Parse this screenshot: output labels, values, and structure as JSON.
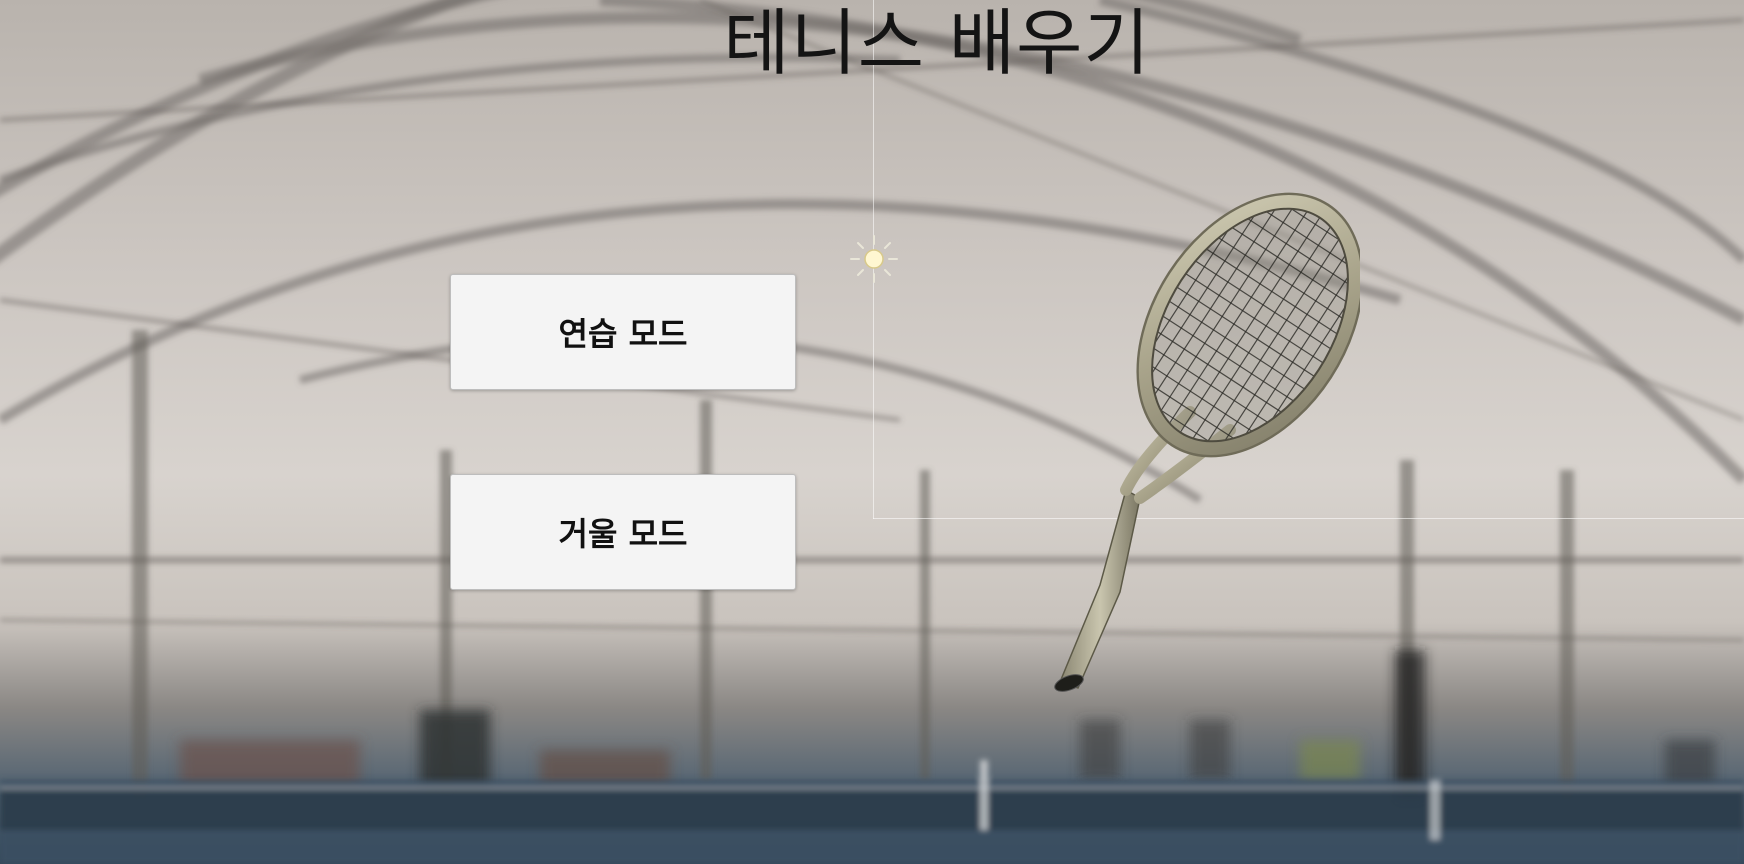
{
  "app": {
    "title": "테니스 배우기"
  },
  "menu": {
    "practice_label": "연습 모드",
    "mirror_label": "거울 모드"
  },
  "scene": {
    "background": "indoor-tennis-court-photo",
    "light_icon": "light-sun-icon",
    "model": "tennis-racket-model"
  },
  "colors": {
    "title": "#141414",
    "button_bg": "#f4f4f4",
    "button_text": "#111111",
    "racket_frame": "#b9b49c",
    "court_floor": "#35485a"
  }
}
